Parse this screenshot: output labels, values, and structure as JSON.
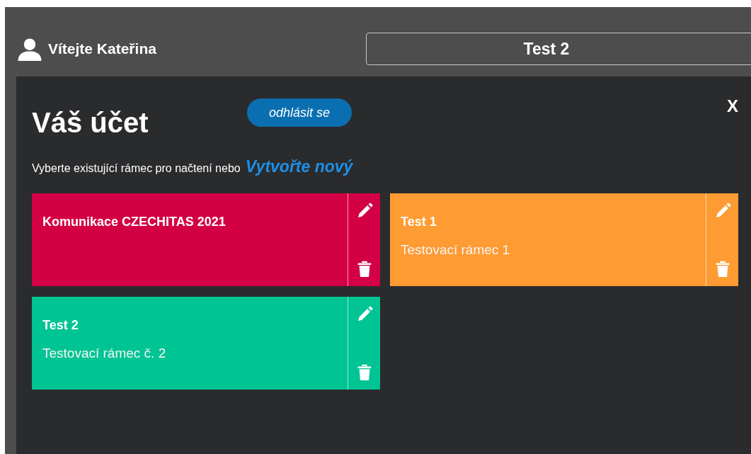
{
  "header": {
    "greeting": "Vítejte Kateřina",
    "current_frame": "Test 2"
  },
  "account": {
    "title": "Váš účet",
    "logout_button": "odhlásit se",
    "close_button": "X",
    "intro_text": "Vyberte existující rámec pro načtení nebo",
    "create_link": "Vytvořte nový"
  },
  "frames": [
    {
      "name": "Komunikace CZECHITAS 2021",
      "color": "#d40045"
    },
    {
      "name": "Test 1",
      "description": "Testovací rámec 1",
      "color": "#ff9b33"
    },
    {
      "name": "Test 2",
      "description": "Testovací rámec č. 2",
      "color": "#00c494"
    }
  ]
}
